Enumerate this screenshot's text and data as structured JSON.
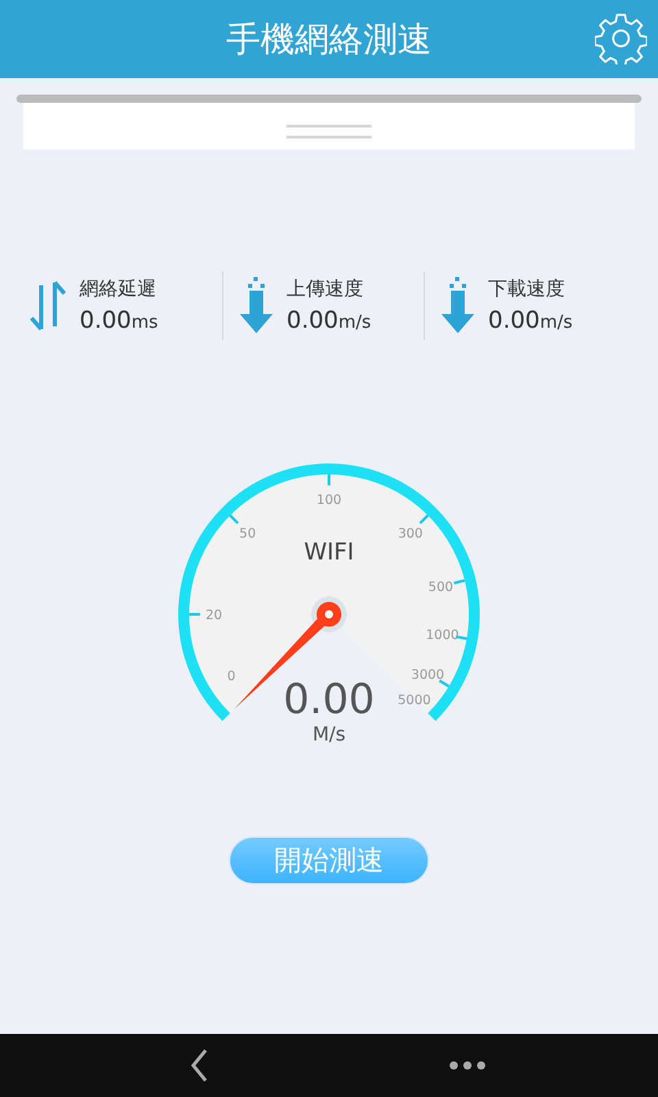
{
  "app_bar": {
    "title": "手機網絡測速"
  },
  "stats": [
    {
      "kind": "latency",
      "label": "網絡延遲",
      "value": "0.00",
      "unit": "ms"
    },
    {
      "kind": "transfer",
      "label": "上傳速度",
      "value": "0.00",
      "unit": "m/s"
    },
    {
      "kind": "transfer",
      "label": "下載速度",
      "value": "0.00",
      "unit": "m/s"
    }
  ],
  "gauge": {
    "network": "WIFI",
    "ticks": [
      "0",
      "20",
      "50",
      "100",
      "300",
      "500",
      "1000",
      "3000",
      "5000"
    ],
    "reading": "0.00",
    "unit": "M/s"
  },
  "start_button": "開始測速"
}
